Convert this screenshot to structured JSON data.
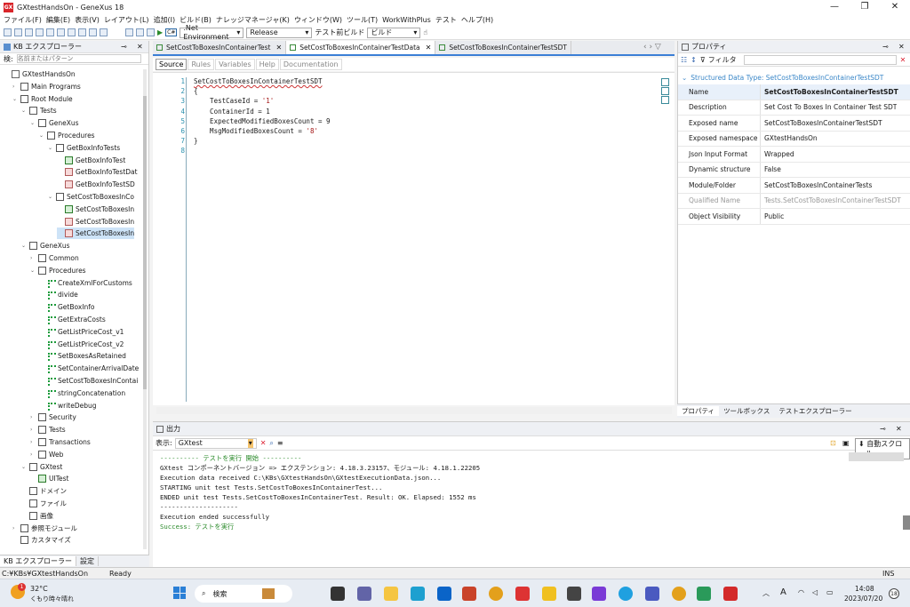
{
  "window": {
    "title": "GXtestHandsOn - GeneXus 18",
    "logo": "GX"
  },
  "menu": [
    "ファイル(F)",
    "編集(E)",
    "表示(V)",
    "レイアウト(L)",
    "追加(I)",
    "ビルド(B)",
    "ナレッジマネージャ(K)",
    "ウィンドウ(W)",
    "ツール(T)",
    "WorkWithPlus",
    "テスト",
    "ヘルプ(H)"
  ],
  "toolbar": {
    "environment": ".Net Environment",
    "config": "Release",
    "test_label": "テスト前ビルド",
    "build": "ビルド",
    "env_icon": "C#"
  },
  "kb": {
    "title": "KB エクスプローラー",
    "search_label": "検:",
    "search_placeholder": "名前またはパターン",
    "tree": [
      {
        "label": "GXtestHandsOn",
        "indent": 0,
        "icon": "kb"
      },
      {
        "label": "Main Programs",
        "indent": 1,
        "icon": "fold",
        "tw": "›"
      },
      {
        "label": "Root Module",
        "indent": 1,
        "icon": "fold",
        "tw": "⌄"
      },
      {
        "label": "Tests",
        "indent": 2,
        "icon": "fold",
        "tw": "⌄"
      },
      {
        "label": "GeneXus",
        "indent": 3,
        "icon": "fold",
        "tw": "⌄"
      },
      {
        "label": "Procedures",
        "indent": 4,
        "icon": "fold",
        "tw": "⌄"
      },
      {
        "label": "GetBoxInfoTests",
        "indent": 5,
        "icon": "fold",
        "tw": "⌄"
      },
      {
        "label": "GetBoxInfoTest",
        "indent": 6,
        "icon": "test"
      },
      {
        "label": "GetBoxInfoTestDat",
        "indent": 6,
        "icon": "sdt"
      },
      {
        "label": "GetBoxInfoTestSD",
        "indent": 6,
        "icon": "sdt"
      },
      {
        "label": "SetCostToBoxesInCo",
        "indent": 5,
        "icon": "fold",
        "tw": "⌄"
      },
      {
        "label": "SetCostToBoxesIn",
        "indent": 6,
        "icon": "test"
      },
      {
        "label": "SetCostToBoxesIn",
        "indent": 6,
        "icon": "sdt"
      },
      {
        "label": "SetCostToBoxesIn",
        "indent": 6,
        "icon": "sdt",
        "sel": true
      },
      {
        "label": "GeneXus",
        "indent": 2,
        "icon": "fold",
        "tw": "⌄"
      },
      {
        "label": "Common",
        "indent": 3,
        "icon": "fold",
        "tw": "›"
      },
      {
        "label": "Procedures",
        "indent": 3,
        "icon": "fold",
        "tw": "⌄"
      },
      {
        "label": "CreateXmlForCustoms",
        "indent": 4,
        "icon": "proc"
      },
      {
        "label": "divide",
        "indent": 4,
        "icon": "proc"
      },
      {
        "label": "GetBoxInfo",
        "indent": 4,
        "icon": "proc"
      },
      {
        "label": "GetExtraCosts",
        "indent": 4,
        "icon": "proc"
      },
      {
        "label": "GetListPriceCost_v1",
        "indent": 4,
        "icon": "proc"
      },
      {
        "label": "GetListPriceCost_v2",
        "indent": 4,
        "icon": "proc"
      },
      {
        "label": "SetBoxesAsRetained",
        "indent": 4,
        "icon": "proc"
      },
      {
        "label": "SetContainerArrivalDate",
        "indent": 4,
        "icon": "proc"
      },
      {
        "label": "SetCostToBoxesInContai",
        "indent": 4,
        "icon": "proc"
      },
      {
        "label": "stringConcatenation",
        "indent": 4,
        "icon": "proc"
      },
      {
        "label": "writeDebug",
        "indent": 4,
        "icon": "proc"
      },
      {
        "label": "Security",
        "indent": 3,
        "icon": "fold",
        "tw": "›"
      },
      {
        "label": "Tests",
        "indent": 3,
        "icon": "fold",
        "tw": "›"
      },
      {
        "label": "Transactions",
        "indent": 3,
        "icon": "fold",
        "tw": "›"
      },
      {
        "label": "Web",
        "indent": 3,
        "icon": "fold",
        "tw": "›"
      },
      {
        "label": "GXtest",
        "indent": 2,
        "icon": "fold",
        "tw": "⌄"
      },
      {
        "label": "UITest",
        "indent": 3,
        "icon": "test"
      },
      {
        "label": "ドメイン",
        "indent": 2,
        "icon": "fold"
      },
      {
        "label": "ファイル",
        "indent": 2,
        "icon": "fold"
      },
      {
        "label": "画像",
        "indent": 2,
        "icon": "fold"
      },
      {
        "label": "参照モジュール",
        "indent": 1,
        "icon": "fold",
        "tw": "›"
      },
      {
        "label": "カスタマイズ",
        "indent": 1,
        "icon": "fold"
      }
    ],
    "bottom_tabs": [
      "KB エクスプローラー",
      "設定"
    ]
  },
  "tabs": [
    {
      "label": "SetCostToBoxesInContainerTest"
    },
    {
      "label": "SetCostToBoxesInContainerTestData",
      "active": true
    },
    {
      "label": "SetCostToBoxesInContainerTestSDT"
    }
  ],
  "subtabs": [
    "Source",
    "Rules",
    "Variables",
    "Help",
    "Documentation"
  ],
  "editor": {
    "lines": [
      {
        "n": "1",
        "t": "SetCostToBoxesInContainerTestSDT"
      },
      {
        "n": "2",
        "t": "{"
      },
      {
        "n": "3",
        "t": "    TestCaseId = ",
        "s": "'1'"
      },
      {
        "n": "4",
        "t": "    ContainerId = 1"
      },
      {
        "n": "5",
        "t": "    ExpectedModifiedBoxesCount = 9"
      },
      {
        "n": "6",
        "t": "    MsgModifiedBoxesCount = ",
        "s": "'8'"
      },
      {
        "n": "7",
        "t": "}"
      },
      {
        "n": "8",
        "t": ""
      }
    ]
  },
  "props": {
    "title": "プロパティ",
    "filter": "フィルタ",
    "type_label": "Structured Data Type: SetCostToBoxesInContainerTestSDT",
    "rows": [
      {
        "k": "Name",
        "v": "SetCostToBoxesInContainerTestSDT",
        "bold": true
      },
      {
        "k": "Description",
        "v": "Set Cost To Boxes In Container Test SDT"
      },
      {
        "k": "Exposed name",
        "v": "SetCostToBoxesInContainerTestSDT"
      },
      {
        "k": "Exposed namespace",
        "v": "GXtestHandsOn"
      },
      {
        "k": "Json Input Format",
        "v": "Wrapped"
      },
      {
        "k": "Dynamic structure",
        "v": "False"
      },
      {
        "k": "Module/Folder",
        "v": "SetCostToBoxesInContainerTests"
      },
      {
        "k": "Qualified Name",
        "v": "Tests.SetCostToBoxesInContainerTestSDT",
        "gray": true
      },
      {
        "k": "Object Visibility",
        "v": "Public"
      }
    ],
    "bottom_tabs": [
      "プロパティ",
      "ツールボックス",
      "テストエクスプローラー"
    ]
  },
  "output": {
    "title": "出力",
    "show_label": "表示:",
    "source": "GXtest",
    "autoscroll": "自動スクロール",
    "lines": [
      {
        "t": "---------- テストを実行 開始 ----------",
        "c": "#2a8a2a"
      },
      {
        "t": "GXtest コンポーネントバージョン => エクステンション: 4.18.3.23157、モジュール: 4.18.1.22205"
      },
      {
        "t": "Execution data received C:\\KBs\\GXtestHandsOn\\GXtestExecutionData.json..."
      },
      {
        "t": "STARTING unit test Tests.SetCostToBoxesInContainerTest..."
      },
      {
        "t": "ENDED unit test Tests.SetCostToBoxesInContainerTest. Result: OK. Elapsed: 1552 ms"
      },
      {
        "t": "--------------------"
      },
      {
        "t": "Execution ended successfully"
      },
      {
        "t": "Success: テストを実行",
        "c": "#2a8a2a"
      }
    ]
  },
  "status": {
    "path": "C:¥KBs¥GXtestHandsOn",
    "state": "Ready",
    "ins": "INS"
  },
  "taskbar": {
    "weather_temp": "32°C",
    "weather_desc": "くもり時々晴れ",
    "search": "検索",
    "time": "14:08",
    "date": "2023/07/20",
    "badge": "18",
    "ime": "A",
    "alert": "1"
  }
}
